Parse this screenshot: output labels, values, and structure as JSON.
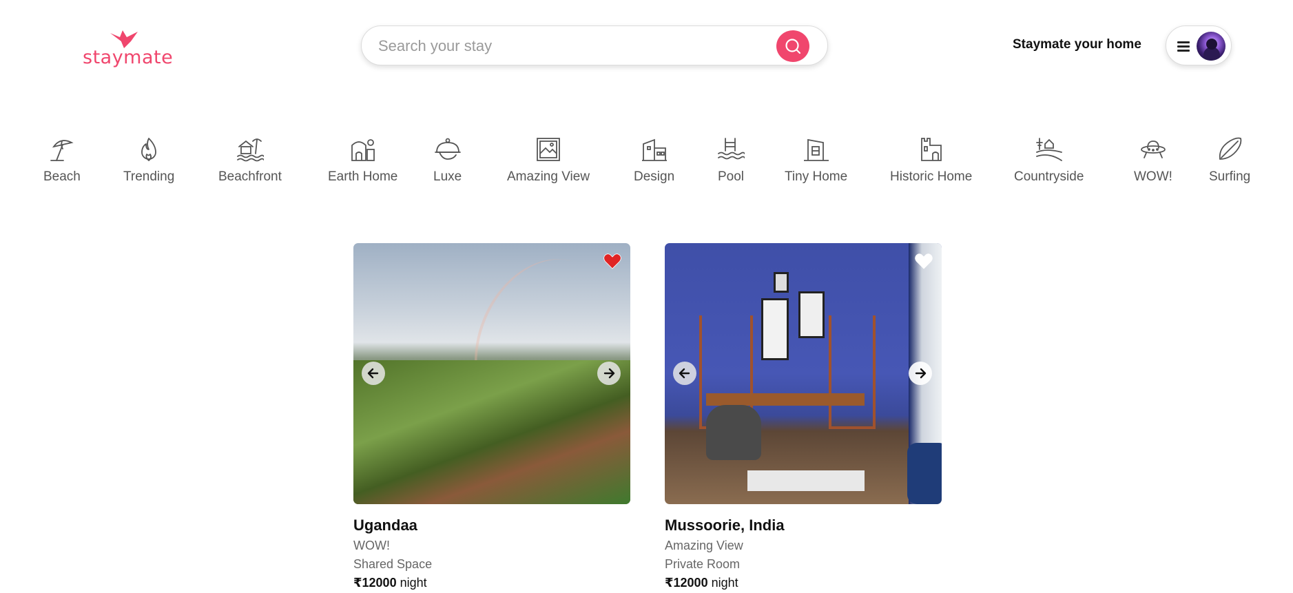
{
  "brand": {
    "name": "staymate",
    "accent": "#f0466d"
  },
  "search": {
    "placeholder": "Search your stay",
    "value": "",
    "icon": "search-icon"
  },
  "header": {
    "host_link": "Staymate your home",
    "menu_icon": "hamburger-icon"
  },
  "categories": [
    {
      "label": "Beach",
      "icon": "beach-umbrella-icon"
    },
    {
      "label": "Trending",
      "icon": "flame-icon"
    },
    {
      "label": "Beachfront",
      "icon": "beachfront-house-icon"
    },
    {
      "label": "Earth Home",
      "icon": "earth-home-icon"
    },
    {
      "label": "Luxe",
      "icon": "cloche-icon"
    },
    {
      "label": "Amazing View",
      "icon": "landscape-frame-icon"
    },
    {
      "label": "Design",
      "icon": "building-design-icon"
    },
    {
      "label": "Pool",
      "icon": "pool-ladder-icon"
    },
    {
      "label": "Tiny Home",
      "icon": "tiny-home-icon"
    },
    {
      "label": "Historic Home",
      "icon": "castle-icon"
    },
    {
      "label": "Countryside",
      "icon": "countryside-icon"
    },
    {
      "label": "WOW!",
      "icon": "ufo-icon"
    },
    {
      "label": "Surfing",
      "icon": "surfboard-icon"
    }
  ],
  "listings": [
    {
      "title": "Ugandaa",
      "category": "WOW!",
      "room_type": "Shared Space",
      "price": "₹12000",
      "price_unit": "night",
      "favorited": true,
      "heart_color": "#e02424"
    },
    {
      "title": "Mussoorie, India",
      "category": "Amazing View",
      "room_type": "Private Room",
      "price": "₹12000",
      "price_unit": "night",
      "favorited": false,
      "heart_color": "#ffffff"
    }
  ]
}
